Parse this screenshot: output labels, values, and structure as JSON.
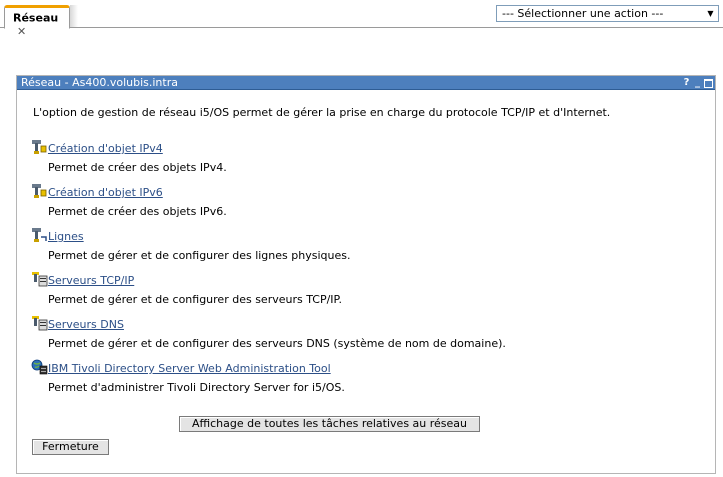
{
  "tabbar": {
    "tab_label": "Réseau",
    "close_glyph": "✕",
    "action_select": {
      "selected": "--- Sélectionner une action ---",
      "arrow": "▼"
    }
  },
  "portlet": {
    "title": "Réseau - As400.volubis.intra",
    "controls": {
      "help": "?",
      "minimize": "_"
    },
    "intro": "L'option de gestion de réseau i5/OS permet de gérer la prise en charge du protocole TCP/IP et d'Internet.",
    "items": [
      {
        "icon": "wrench-object-icon",
        "link": "Création d'objet IPv4",
        "desc": "Permet de créer des objets IPv4."
      },
      {
        "icon": "wrench-object-icon",
        "link": "Création d'objet IPv6",
        "desc": "Permet de créer des objets IPv6."
      },
      {
        "icon": "wrench-line-icon",
        "link": "Lignes",
        "desc": "Permet de gérer et de configurer des lignes physiques."
      },
      {
        "icon": "server-wrench-icon",
        "link": "Serveurs TCP/IP",
        "desc": "Permet de gérer et de configurer des serveurs TCP/IP."
      },
      {
        "icon": "server-wrench-icon",
        "link": "Serveurs DNS",
        "desc": "Permet de gérer et de configurer des serveurs DNS (système de nom de domaine)."
      },
      {
        "icon": "globe-server-icon",
        "link": "IBM Tivoli Directory Server Web Administration Tool",
        "desc": "Permet d'administrer Tivoli Directory Server for i5/OS."
      }
    ],
    "show_all_button": "Affichage de toutes les tâches relatives au réseau",
    "close_button": "Fermeture"
  },
  "colors": {
    "title_bar": "#4d7fbd",
    "tab_accent": "#f0a000",
    "link": "#2c4f87"
  }
}
